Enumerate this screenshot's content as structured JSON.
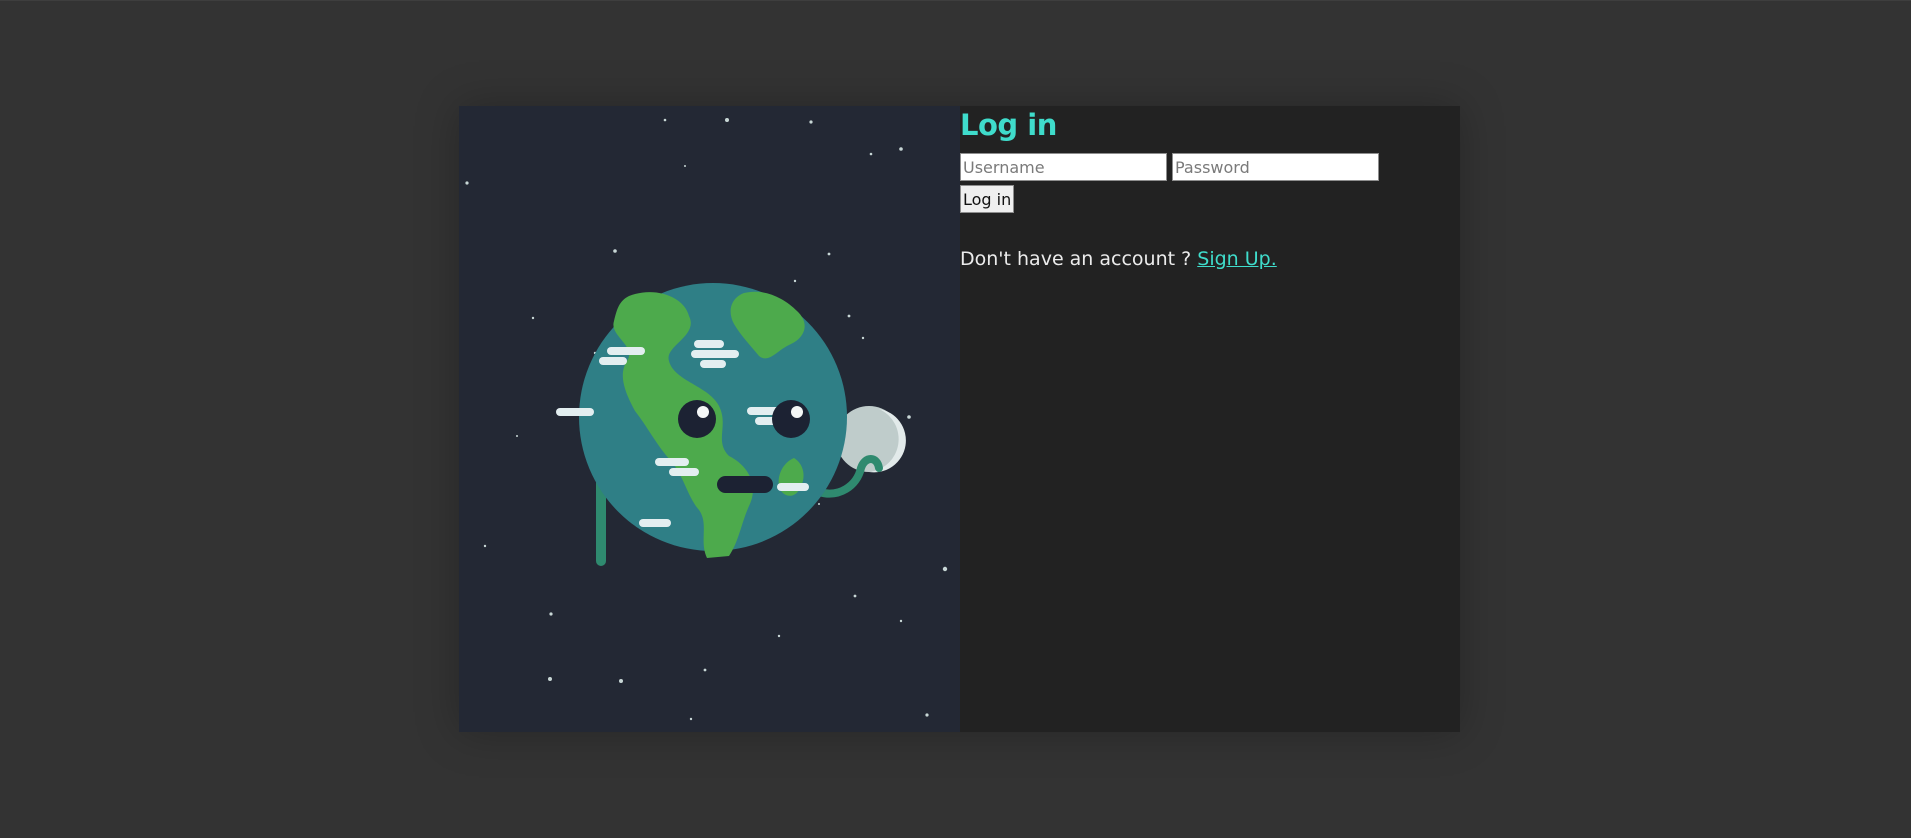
{
  "login": {
    "title": "Log in",
    "username_placeholder": "Username",
    "password_placeholder": "Password",
    "submit_label": "Log in",
    "signup_prompt": "Don't have an account ?",
    "signup_link": "Sign Up."
  },
  "illustration": {
    "icon": "earth-character-icon"
  },
  "colors": {
    "accent": "#3fdccb",
    "page_background": "#333333",
    "panel_background": "#222222",
    "illustration_background": "#232834"
  }
}
